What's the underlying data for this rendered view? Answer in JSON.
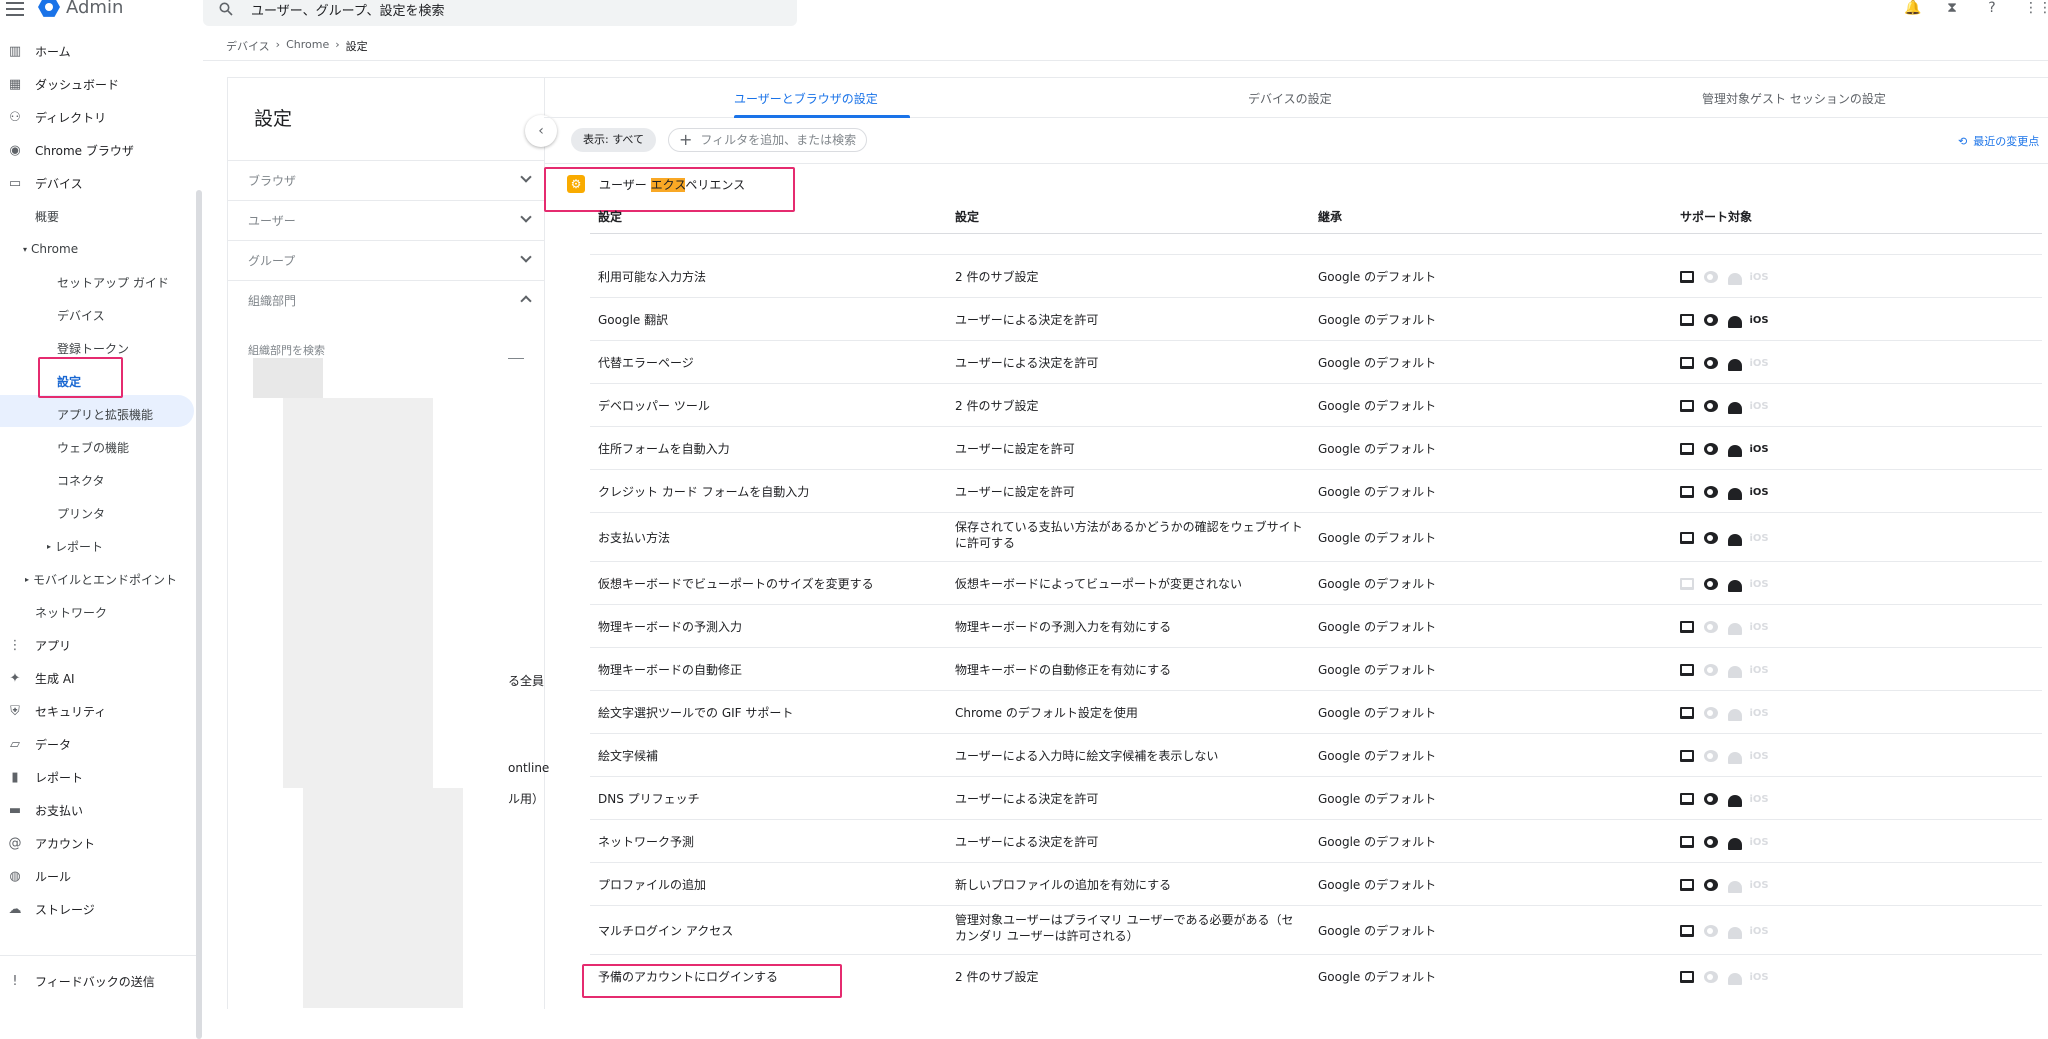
{
  "app": {
    "title": "Admin"
  },
  "search": {
    "placeholder": "ユーザー、グループ、設定を検索"
  },
  "sidebar": {
    "items": [
      {
        "label": "ホーム",
        "icon": "chart-icon"
      },
      {
        "label": "ダッシュボード",
        "icon": "dashboard-icon"
      },
      {
        "label": "ディレクトリ",
        "icon": "person-icon"
      },
      {
        "label": "Chrome ブラウザ",
        "icon": "chrome-icon"
      },
      {
        "label": "デバイス",
        "icon": "devices-icon"
      }
    ],
    "devices_sub": [
      {
        "label": "概要"
      },
      {
        "label": "Chrome"
      }
    ],
    "chrome_sub": [
      {
        "label": "セットアップ ガイド"
      },
      {
        "label": "デバイス"
      },
      {
        "label": "登録トークン"
      },
      {
        "label": "設定"
      },
      {
        "label": "アプリと拡張機能"
      },
      {
        "label": "ウェブの機能"
      },
      {
        "label": "コネクタ"
      },
      {
        "label": "プリンタ"
      },
      {
        "label": "レポート"
      }
    ],
    "more_sub": [
      {
        "label": "モバイルとエンドポイント"
      },
      {
        "label": "ネットワーク"
      }
    ],
    "items2": [
      {
        "label": "アプリ",
        "icon": "apps-icon"
      },
      {
        "label": "生成 AI",
        "icon": "sparkle-icon"
      },
      {
        "label": "セキュリティ",
        "icon": "shield-icon"
      },
      {
        "label": "データ",
        "icon": "folder-icon"
      },
      {
        "label": "レポート",
        "icon": "bar-chart-icon"
      },
      {
        "label": "お支払い",
        "icon": "card-icon"
      },
      {
        "label": "アカウント",
        "icon": "at-icon"
      },
      {
        "label": "ルール",
        "icon": "globe-icon"
      },
      {
        "label": "ストレージ",
        "icon": "cloud-icon"
      }
    ],
    "feedback": "フィードバックの送信"
  },
  "breadcrumb": [
    "デバイス",
    "Chrome",
    "設定"
  ],
  "left_panel": {
    "title": "設定",
    "filters": [
      {
        "label": "ブラウザ"
      },
      {
        "label": "ユーザー"
      },
      {
        "label": "グループ"
      },
      {
        "label": "組織部門"
      }
    ],
    "ou_search_placeholder": "組織部門を検索",
    "fragments": [
      "る全員",
      "ontline",
      "ル用）"
    ]
  },
  "tabs": [
    {
      "label": "ユーザーとブラウザの設定"
    },
    {
      "label": "デバイスの設定"
    },
    {
      "label": "管理対象ゲスト セッションの設定"
    }
  ],
  "toolbar": {
    "show_chip": "表示: すべて",
    "filter_chip": "フィルタを追加、または検索",
    "recent_changes": "最近の変更点"
  },
  "section": {
    "title_pre": "ユーザー ",
    "title_hl": "エクス",
    "title_post": "ペリエンス"
  },
  "table": {
    "headers": [
      "設定",
      "設定",
      "継承",
      "サポート対象"
    ],
    "rows": [
      {
        "setting": "利用可能な入力方法",
        "value": "2 件のサブ設定",
        "inherit": "Google のデフォルト",
        "support": [
          1,
          0,
          0,
          0
        ]
      },
      {
        "setting": "Google 翻訳",
        "value": "ユーザーによる決定を許可",
        "inherit": "Google のデフォルト",
        "support": [
          1,
          1,
          1,
          1
        ]
      },
      {
        "setting": "代替エラーページ",
        "value": "ユーザーによる決定を許可",
        "inherit": "Google のデフォルト",
        "support": [
          1,
          1,
          1,
          0
        ]
      },
      {
        "setting": "デベロッパー ツール",
        "value": "2 件のサブ設定",
        "inherit": "Google のデフォルト",
        "support": [
          1,
          1,
          1,
          0
        ]
      },
      {
        "setting": "住所フォームを自動入力",
        "value": "ユーザーに設定を許可",
        "inherit": "Google のデフォルト",
        "support": [
          1,
          1,
          1,
          1
        ]
      },
      {
        "setting": "クレジット カード フォームを自動入力",
        "value": "ユーザーに設定を許可",
        "inherit": "Google のデフォルト",
        "support": [
          1,
          1,
          1,
          1
        ]
      },
      {
        "setting": "お支払い方法",
        "value": "保存されている支払い方法があるかどうかの確認をウェブサイトに許可する",
        "inherit": "Google のデフォルト",
        "support": [
          1,
          1,
          1,
          0
        ]
      },
      {
        "setting": "仮想キーボードでビューポートのサイズを変更する",
        "value": "仮想キーボードによってビューポートが変更されない",
        "inherit": "Google のデフォルト",
        "support": [
          0,
          1,
          1,
          0
        ]
      },
      {
        "setting": "物理キーボードの予測入力",
        "value": "物理キーボードの予測入力を有効にする",
        "inherit": "Google のデフォルト",
        "support": [
          1,
          0,
          0,
          0
        ]
      },
      {
        "setting": "物理キーボードの自動修正",
        "value": "物理キーボードの自動修正を有効にする",
        "inherit": "Google のデフォルト",
        "support": [
          1,
          0,
          0,
          0
        ]
      },
      {
        "setting": "絵文字選択ツールでの GIF サポート",
        "value": "Chrome のデフォルト設定を使用",
        "inherit": "Google のデフォルト",
        "support": [
          1,
          0,
          0,
          0
        ]
      },
      {
        "setting": "絵文字候補",
        "value": "ユーザーによる入力時に絵文字候補を表示しない",
        "inherit": "Google のデフォルト",
        "support": [
          1,
          0,
          0,
          0
        ]
      },
      {
        "setting": "DNS プリフェッチ",
        "value": "ユーザーによる決定を許可",
        "inherit": "Google のデフォルト",
        "support": [
          1,
          1,
          1,
          0
        ]
      },
      {
        "setting": "ネットワーク予測",
        "value": "ユーザーによる決定を許可",
        "inherit": "Google のデフォルト",
        "support": [
          1,
          1,
          1,
          0
        ]
      },
      {
        "setting": "プロファイルの追加",
        "value": "新しいプロファイルの追加を有効にする",
        "inherit": "Google のデフォルト",
        "support": [
          1,
          1,
          0,
          0
        ]
      },
      {
        "setting": "マルチログイン アクセス",
        "value": "管理対象ユーザーはプライマリ ユーザーである必要がある（セカンダリ ユーザーは許可される）",
        "inherit": "Google のデフォルト",
        "support": [
          1,
          0,
          0,
          0
        ]
      },
      {
        "setting": "予備のアカウントにログインする",
        "value": "2 件のサブ設定",
        "inherit": "Google のデフォルト",
        "support": [
          1,
          0,
          0,
          0
        ]
      }
    ]
  }
}
